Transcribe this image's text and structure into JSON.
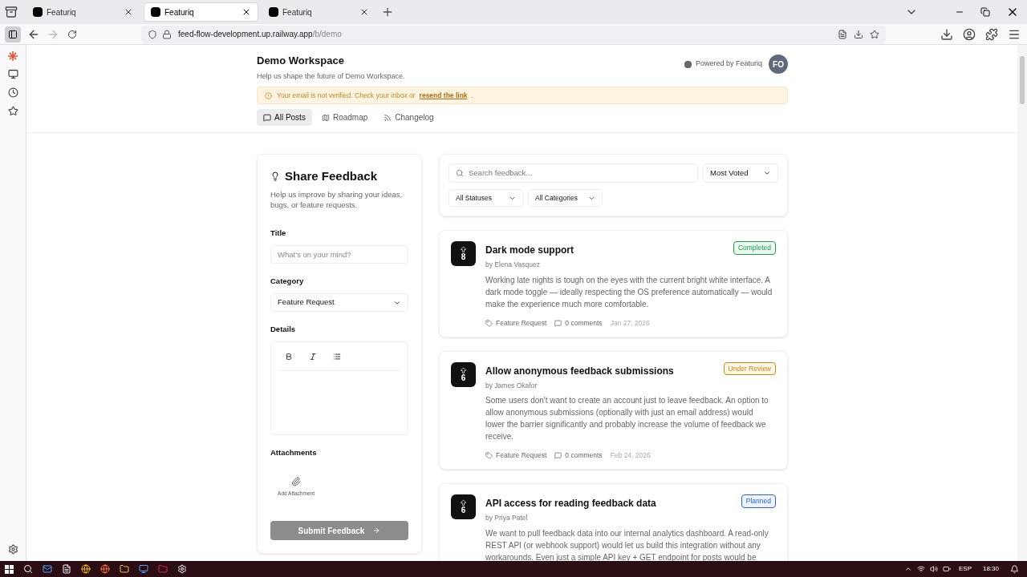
{
  "browser": {
    "tabs": [
      {
        "title": "Featuriq",
        "selected": false
      },
      {
        "title": "Featuriq",
        "selected": true
      },
      {
        "title": "Featuriq",
        "selected": false
      }
    ],
    "url": {
      "host": "feed-flow-development.up.railway.app",
      "path": "/b/demo"
    }
  },
  "header": {
    "title": "Demo Workspace",
    "subtitle": "Help us shape the future of Demo Workspace.",
    "powered_by": "Powered by Featuriq",
    "avatar": "FO"
  },
  "alert": {
    "text": "Your email is not verified. Check your inbox or",
    "link": "resend the link",
    "end": "."
  },
  "nav": [
    {
      "label": "All Posts",
      "selected": true
    },
    {
      "label": "Roadmap",
      "selected": false
    },
    {
      "label": "Changelog",
      "selected": false
    }
  ],
  "form": {
    "title": "Share Feedback",
    "description": "Help us improve by sharing your ideas, bugs, or feature requests.",
    "title_label": "Title",
    "title_placeholder": "What's on your mind?",
    "category_label": "Category",
    "category_value": "Feature Request",
    "details_label": "Details",
    "attachments_label": "Attachments",
    "add_attachment": "Add Attachment",
    "submit": "Submit Feedback",
    "submit_disabled": true
  },
  "filters": {
    "search_placeholder": "Search feedback...",
    "sort": "Most Voted",
    "status": "All Statuses",
    "category": "All Categories"
  },
  "posts": [
    {
      "votes": "8",
      "title": "Dark mode support",
      "author": "by Elena Vasquez",
      "status": "Completed",
      "color": "#16a34a",
      "body": "Working late nights is tough on the eyes with the current bright white interface. A dark mode toggle — ideally respecting the OS preference automatically — would make the experience much more comfortable.",
      "category": "Feature Request",
      "comments": "0 comments",
      "date": "Jan 27, 2026"
    },
    {
      "votes": "6",
      "title": "Allow anonymous feedback submissions",
      "author": "by James Okafor",
      "status": "Under Review",
      "color": "#ca8a04",
      "body": "Some users don't want to create an account just to leave feedback. An option to allow anonymous submissions (optionally with just an email address) would lower the barrier significantly and probably increase the volume of feedback we receive.",
      "category": "Feature Request",
      "comments": "0 comments",
      "date": "Feb 24, 2026"
    },
    {
      "votes": "6",
      "title": "API access for reading feedback data",
      "author": "by Priya Patel",
      "status": "Planned",
      "color": "#2563eb",
      "body": "We want to pull feedback data into our internal analytics dashboard. A read-only REST API (or webhook support) would let us build this integration without any workarounds. Even just a simple API key + GET endpoint for posts would be"
    }
  ],
  "taskbar": {
    "language": "ESP",
    "time": "18:30"
  }
}
